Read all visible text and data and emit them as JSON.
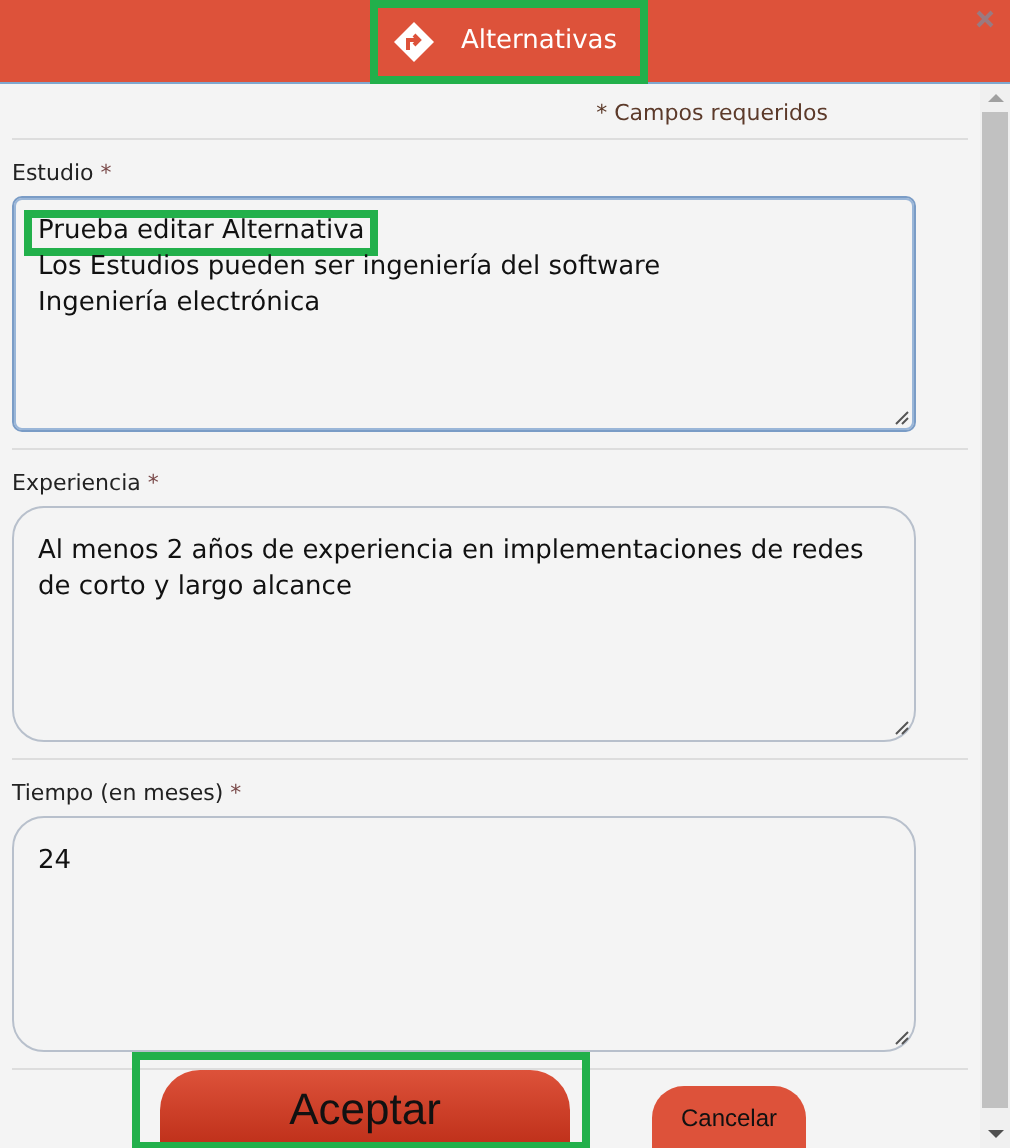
{
  "dialog": {
    "title": "Alternativas",
    "required_note": "* Campos requeridos"
  },
  "fields": [
    {
      "label": "Estudio",
      "required_mark": "*",
      "focused": true,
      "lines": [
        {
          "text": "Prueba editar Alternativa",
          "highlighted": true
        },
        {
          "text": "Los Estudios pueden ser ingeniería del software",
          "highlighted": false
        },
        {
          "text": "Ingeniería electrónica",
          "highlighted": false
        }
      ]
    },
    {
      "label": "Experiencia",
      "required_mark": "*",
      "focused": false,
      "lines": [
        {
          "text": "Al menos 2 años de experiencia en implementaciones de redes de corto y largo alcance",
          "highlighted": false
        }
      ]
    },
    {
      "label": "Tiempo (en meses)",
      "required_mark": "*",
      "focused": false,
      "lines": [
        {
          "text": "24",
          "highlighted": false
        }
      ]
    }
  ],
  "buttons": [
    {
      "label": "Aceptar",
      "kind": "primary",
      "highlighted": true
    },
    {
      "label": "Cancelar",
      "kind": "secondary",
      "highlighted": false
    }
  ],
  "title_highlighted": true
}
